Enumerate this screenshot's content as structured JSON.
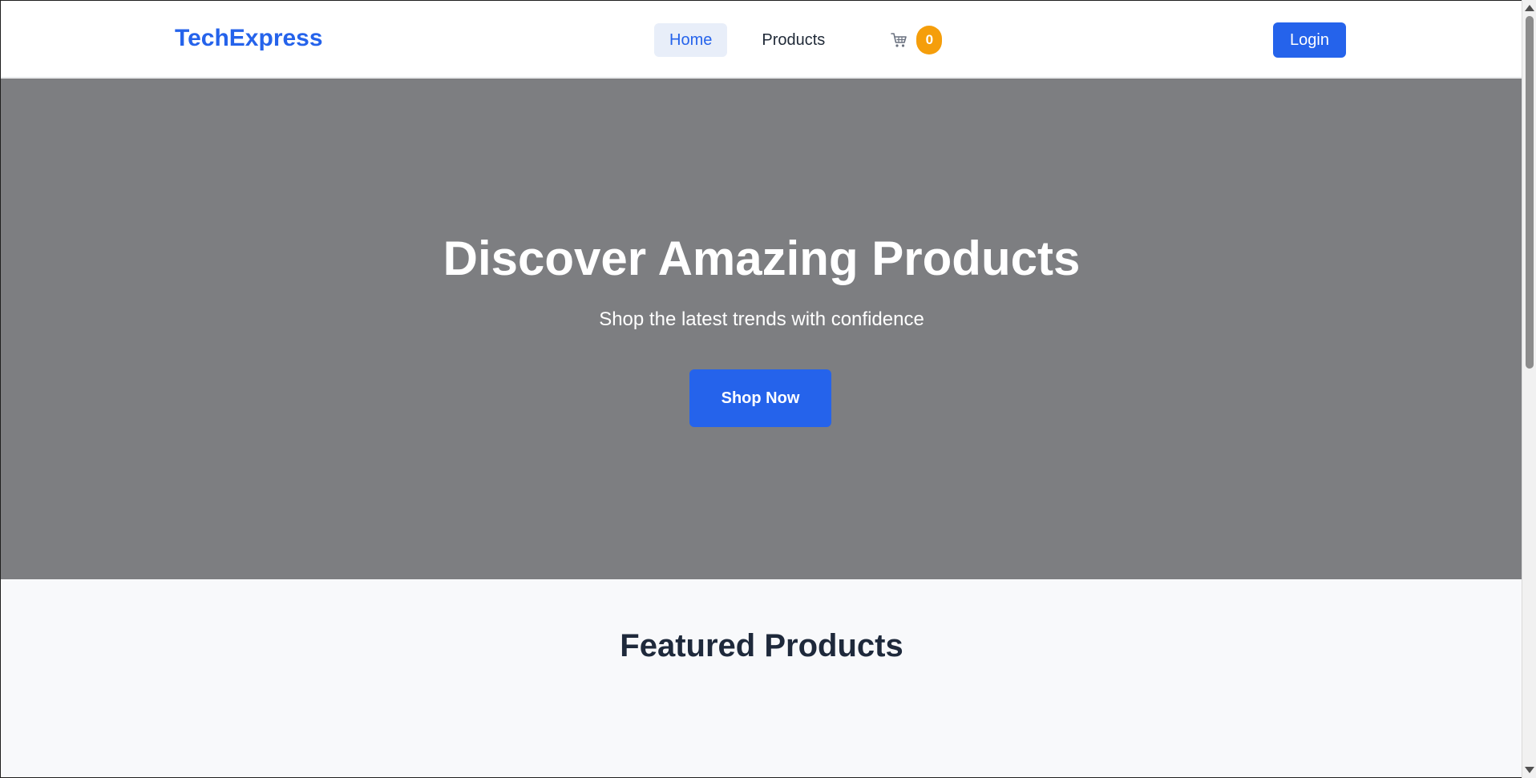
{
  "header": {
    "logo": "TechExpress",
    "nav": [
      {
        "label": "Home",
        "active": true
      },
      {
        "label": "Products",
        "active": false
      }
    ],
    "cart": {
      "icon": "cart-icon",
      "count": "0"
    },
    "login_label": "Login"
  },
  "hero": {
    "title": "Discover Amazing Products",
    "subtitle": "Shop the latest trends with confidence",
    "cta_label": "Shop Now"
  },
  "featured": {
    "title": "Featured Products"
  },
  "colors": {
    "brand": "#2563eb",
    "badge": "#f59e0b",
    "hero_bg": "#7d7e81",
    "featured_bg": "#f8f9fb"
  }
}
